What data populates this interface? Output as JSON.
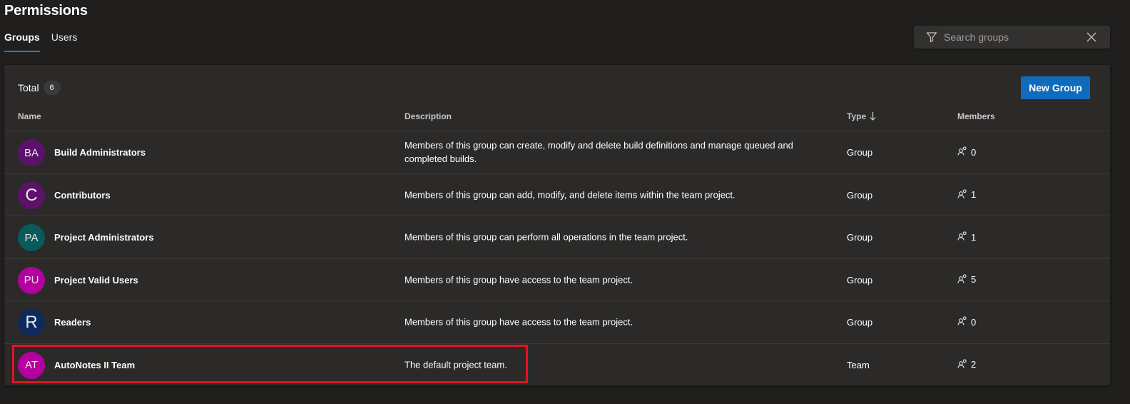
{
  "page": {
    "title": "Permissions"
  },
  "tabs": [
    {
      "label": "Groups",
      "active": true
    },
    {
      "label": "Users",
      "active": false
    }
  ],
  "search": {
    "placeholder": "Search groups",
    "value": ""
  },
  "summary": {
    "total_label": "Total",
    "total_count": "6"
  },
  "actions": {
    "new_group_label": "New Group"
  },
  "table": {
    "headers": {
      "name": "Name",
      "description": "Description",
      "type": "Type",
      "members": "Members"
    },
    "sort": {
      "column": "Type",
      "direction": "descending"
    },
    "rows": [
      {
        "initials": "BA",
        "avatar_color": "#5c126b",
        "name": "Build Administrators",
        "description": "Members of this group can create, modify and delete build definitions and manage queued and completed builds.",
        "type": "Group",
        "members": "0"
      },
      {
        "initials": "C",
        "avatar_color": "#5c126b",
        "name": "Contributors",
        "description": "Members of this group can add, modify, and delete items within the team project.",
        "type": "Group",
        "members": "1"
      },
      {
        "initials": "PA",
        "avatar_color": "#0b5a5a",
        "name": "Project Administrators",
        "description": "Members of this group can perform all operations in the team project.",
        "type": "Group",
        "members": "1"
      },
      {
        "initials": "PU",
        "avatar_color": "#b4009e",
        "name": "Project Valid Users",
        "description": "Members of this group have access to the team project.",
        "type": "Group",
        "members": "5"
      },
      {
        "initials": "R",
        "avatar_color": "#0c2a5e",
        "name": "Readers",
        "description": "Members of this group have access to the team project.",
        "type": "Group",
        "members": "0"
      },
      {
        "initials": "AT",
        "avatar_color": "#b4009e",
        "name": "AutoNotes II Team",
        "description": "The default project team.",
        "type": "Team",
        "members": "2",
        "highlighted": true
      }
    ]
  },
  "colors": {
    "accent": "#0f6cbd",
    "highlight_border": "#e81123",
    "background": "#201f1e",
    "card": "#2b2a29"
  }
}
